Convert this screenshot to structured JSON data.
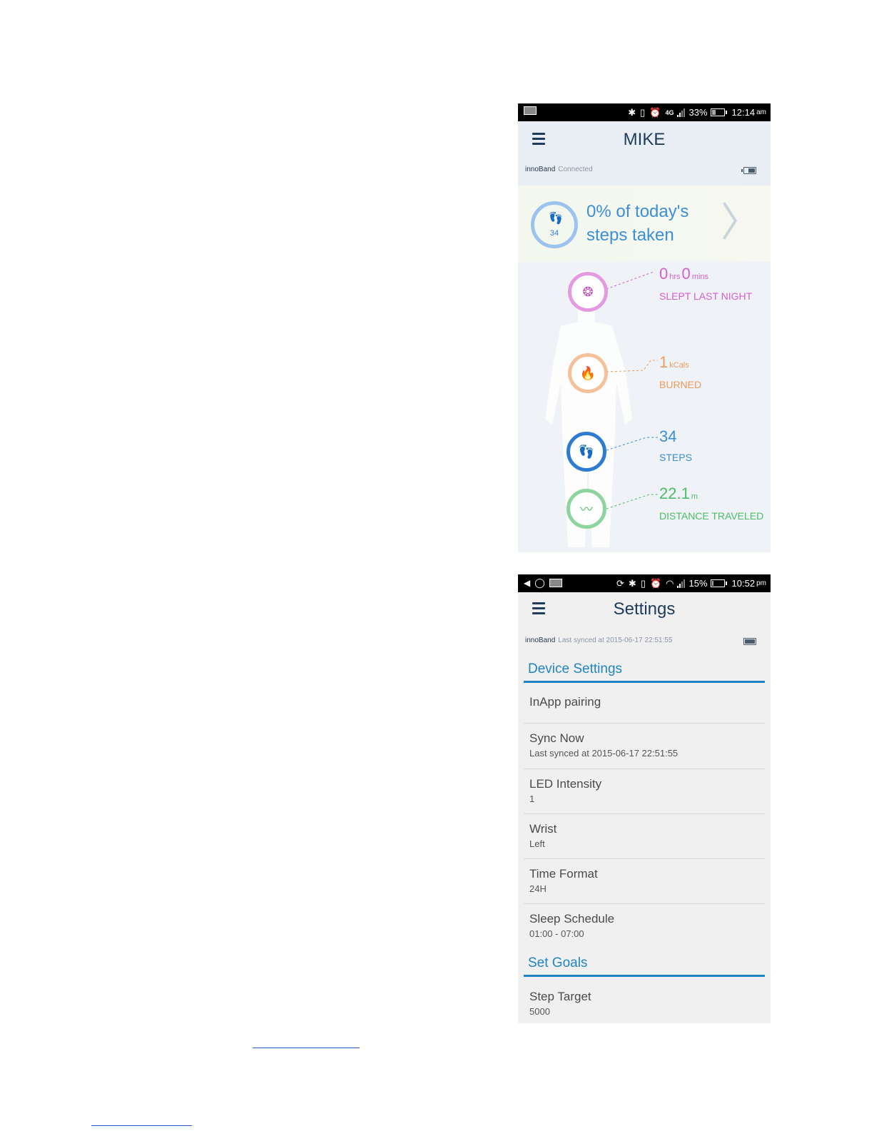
{
  "screen1": {
    "status": {
      "battery": "33%",
      "time": "12:14",
      "ampm": "am",
      "network": "4G"
    },
    "title": "MIKE",
    "device": "innoBand",
    "device_status": "Connected",
    "banner": {
      "steps_count": "34",
      "line1": "0% of today's",
      "line2": "steps taken",
      "percent": 0
    },
    "stats": {
      "sleep": {
        "hrs": "0",
        "hrs_unit": "hrs",
        "mins": "0",
        "mins_unit": "mins",
        "label": "SLEPT LAST NIGHT",
        "color": "#d55fd0"
      },
      "calories": {
        "value": "1",
        "unit": "kCals",
        "label": "BURNED",
        "color": "#ee9b5b"
      },
      "steps": {
        "value": "34",
        "label": "STEPS",
        "color": "#3a8fd6"
      },
      "distance": {
        "value": "22.1",
        "unit": "m",
        "label": "DISTANCE TRAVELED",
        "color": "#4dbd66"
      }
    }
  },
  "screen2": {
    "status": {
      "battery": "15%",
      "time": "10:52",
      "ampm": "pm"
    },
    "title": "Settings",
    "device": "innoBand",
    "device_status": "Last synced at 2015-06-17 22:51:55",
    "device_settings_header": "Device Settings",
    "rows": [
      {
        "title": "InApp pairing",
        "sub": ""
      },
      {
        "title": "Sync Now",
        "sub": "Last synced at 2015-06-17 22:51:55"
      },
      {
        "title": "LED Intensity",
        "sub": "1"
      },
      {
        "title": "Wrist",
        "sub": "Left"
      },
      {
        "title": "Time Format",
        "sub": "24H"
      },
      {
        "title": "Sleep Schedule",
        "sub": "01:00 - 07:00"
      }
    ],
    "goals_header": "Set Goals",
    "goal_rows": [
      {
        "title": "Step Target",
        "sub": "5000"
      }
    ]
  },
  "colors": {
    "accent": "#1f84c5",
    "banner_blue": "#3c8fd6"
  }
}
